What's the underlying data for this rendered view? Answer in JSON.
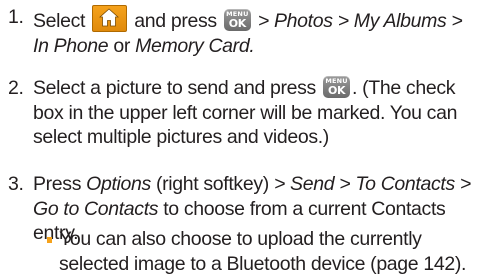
{
  "steps": [
    {
      "number": "1.",
      "select": "Select",
      "and_press": "and press",
      "path_1": "> Photos > My Albums >",
      "in_phone": "In Phone",
      "or": " or ",
      "memory_card": "Memory Card."
    },
    {
      "number": "2.",
      "text_a": "Select a picture to send and press",
      "text_b": ". (The check box in the upper left corner will be marked. You can select multiple pictures and videos.)"
    },
    {
      "number": "3.",
      "press": "Press ",
      "options": "Options",
      "right_softkey": " (right softkey) ",
      "path_send": "> Send > To Contacts >",
      "go_to_contacts": "Go to Contacts",
      "rest": " to choose from a current Contacts entry."
    }
  ],
  "bullet": {
    "text": "You can also choose to upload the currently selected image to a Bluetooth device (page 142)."
  },
  "icons": {
    "home_key": "home-icon",
    "menu_ok_key": "menu-ok-icon",
    "menu_label": "MENU",
    "ok_label": "OK"
  },
  "colors": {
    "home_icon": "#f5a21c",
    "bullet": "#f5a21c",
    "ok_icon": "#7a7a7a",
    "text": "#231f20"
  }
}
